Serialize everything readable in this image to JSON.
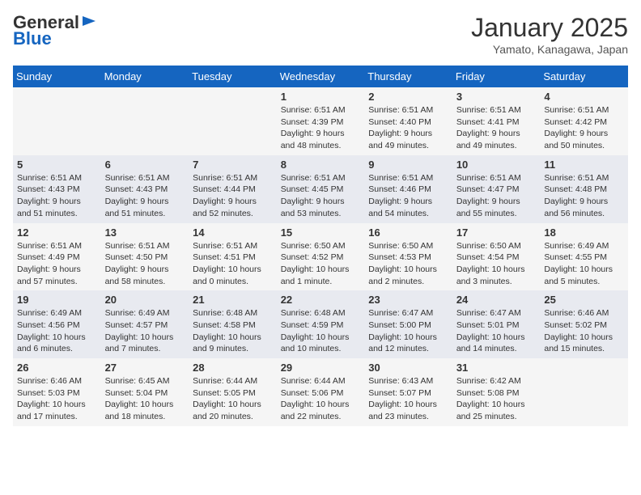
{
  "header": {
    "logo_general": "General",
    "logo_blue": "Blue",
    "month": "January 2025",
    "location": "Yamato, Kanagawa, Japan"
  },
  "days_of_week": [
    "Sunday",
    "Monday",
    "Tuesday",
    "Wednesday",
    "Thursday",
    "Friday",
    "Saturday"
  ],
  "weeks": [
    [
      {
        "day": "",
        "info": ""
      },
      {
        "day": "",
        "info": ""
      },
      {
        "day": "",
        "info": ""
      },
      {
        "day": "1",
        "info": "Sunrise: 6:51 AM\nSunset: 4:39 PM\nDaylight: 9 hours and 48 minutes."
      },
      {
        "day": "2",
        "info": "Sunrise: 6:51 AM\nSunset: 4:40 PM\nDaylight: 9 hours and 49 minutes."
      },
      {
        "day": "3",
        "info": "Sunrise: 6:51 AM\nSunset: 4:41 PM\nDaylight: 9 hours and 49 minutes."
      },
      {
        "day": "4",
        "info": "Sunrise: 6:51 AM\nSunset: 4:42 PM\nDaylight: 9 hours and 50 minutes."
      }
    ],
    [
      {
        "day": "5",
        "info": "Sunrise: 6:51 AM\nSunset: 4:43 PM\nDaylight: 9 hours and 51 minutes."
      },
      {
        "day": "6",
        "info": "Sunrise: 6:51 AM\nSunset: 4:43 PM\nDaylight: 9 hours and 51 minutes."
      },
      {
        "day": "7",
        "info": "Sunrise: 6:51 AM\nSunset: 4:44 PM\nDaylight: 9 hours and 52 minutes."
      },
      {
        "day": "8",
        "info": "Sunrise: 6:51 AM\nSunset: 4:45 PM\nDaylight: 9 hours and 53 minutes."
      },
      {
        "day": "9",
        "info": "Sunrise: 6:51 AM\nSunset: 4:46 PM\nDaylight: 9 hours and 54 minutes."
      },
      {
        "day": "10",
        "info": "Sunrise: 6:51 AM\nSunset: 4:47 PM\nDaylight: 9 hours and 55 minutes."
      },
      {
        "day": "11",
        "info": "Sunrise: 6:51 AM\nSunset: 4:48 PM\nDaylight: 9 hours and 56 minutes."
      }
    ],
    [
      {
        "day": "12",
        "info": "Sunrise: 6:51 AM\nSunset: 4:49 PM\nDaylight: 9 hours and 57 minutes."
      },
      {
        "day": "13",
        "info": "Sunrise: 6:51 AM\nSunset: 4:50 PM\nDaylight: 9 hours and 58 minutes."
      },
      {
        "day": "14",
        "info": "Sunrise: 6:51 AM\nSunset: 4:51 PM\nDaylight: 10 hours and 0 minutes."
      },
      {
        "day": "15",
        "info": "Sunrise: 6:50 AM\nSunset: 4:52 PM\nDaylight: 10 hours and 1 minute."
      },
      {
        "day": "16",
        "info": "Sunrise: 6:50 AM\nSunset: 4:53 PM\nDaylight: 10 hours and 2 minutes."
      },
      {
        "day": "17",
        "info": "Sunrise: 6:50 AM\nSunset: 4:54 PM\nDaylight: 10 hours and 3 minutes."
      },
      {
        "day": "18",
        "info": "Sunrise: 6:49 AM\nSunset: 4:55 PM\nDaylight: 10 hours and 5 minutes."
      }
    ],
    [
      {
        "day": "19",
        "info": "Sunrise: 6:49 AM\nSunset: 4:56 PM\nDaylight: 10 hours and 6 minutes."
      },
      {
        "day": "20",
        "info": "Sunrise: 6:49 AM\nSunset: 4:57 PM\nDaylight: 10 hours and 7 minutes."
      },
      {
        "day": "21",
        "info": "Sunrise: 6:48 AM\nSunset: 4:58 PM\nDaylight: 10 hours and 9 minutes."
      },
      {
        "day": "22",
        "info": "Sunrise: 6:48 AM\nSunset: 4:59 PM\nDaylight: 10 hours and 10 minutes."
      },
      {
        "day": "23",
        "info": "Sunrise: 6:47 AM\nSunset: 5:00 PM\nDaylight: 10 hours and 12 minutes."
      },
      {
        "day": "24",
        "info": "Sunrise: 6:47 AM\nSunset: 5:01 PM\nDaylight: 10 hours and 14 minutes."
      },
      {
        "day": "25",
        "info": "Sunrise: 6:46 AM\nSunset: 5:02 PM\nDaylight: 10 hours and 15 minutes."
      }
    ],
    [
      {
        "day": "26",
        "info": "Sunrise: 6:46 AM\nSunset: 5:03 PM\nDaylight: 10 hours and 17 minutes."
      },
      {
        "day": "27",
        "info": "Sunrise: 6:45 AM\nSunset: 5:04 PM\nDaylight: 10 hours and 18 minutes."
      },
      {
        "day": "28",
        "info": "Sunrise: 6:44 AM\nSunset: 5:05 PM\nDaylight: 10 hours and 20 minutes."
      },
      {
        "day": "29",
        "info": "Sunrise: 6:44 AM\nSunset: 5:06 PM\nDaylight: 10 hours and 22 minutes."
      },
      {
        "day": "30",
        "info": "Sunrise: 6:43 AM\nSunset: 5:07 PM\nDaylight: 10 hours and 23 minutes."
      },
      {
        "day": "31",
        "info": "Sunrise: 6:42 AM\nSunset: 5:08 PM\nDaylight: 10 hours and 25 minutes."
      },
      {
        "day": "",
        "info": ""
      }
    ]
  ]
}
